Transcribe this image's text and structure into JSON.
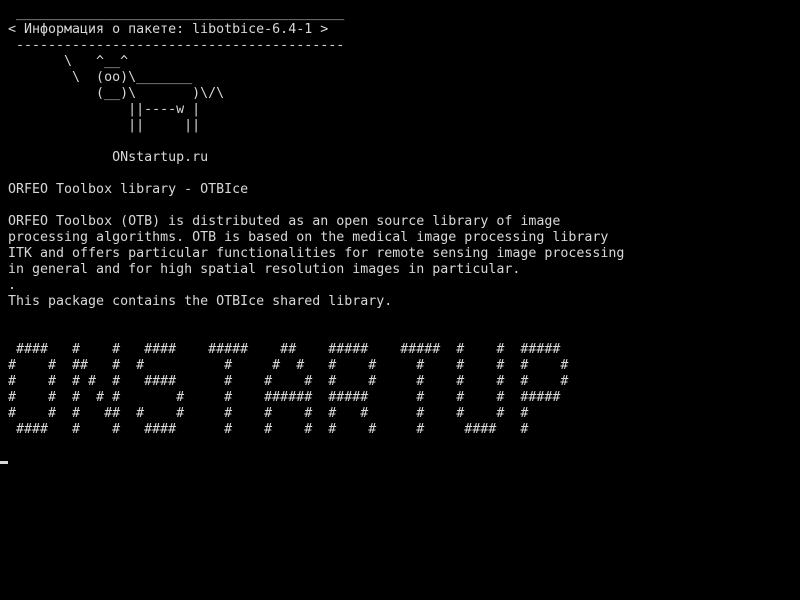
{
  "terminal": {
    "background": "#000000",
    "foreground": "#d8d8d8",
    "lines": [
      " _________________________________________",
      "< Информация о пакете: libotbice-6.4-1 >",
      " -----------------------------------------",
      "       \\   ^__^",
      "        \\  (oo)\\_______",
      "           (__)\\       )\\/\\",
      "               ||----w |",
      "               ||     ||",
      "",
      "             ONstartup.ru",
      "",
      "ORFEO Toolbox library - OTBIce",
      "",
      "ORFEO Toolbox (OTB) is distributed as an open source library of image",
      "processing algorithms. OTB is based on the medical image processing library",
      "ITK and offers particular functionalities for remote sensing image processing",
      "in general and for high spatial resolution images in particular.",
      ".",
      "This package contains the OTBIce shared library.",
      "",
      "",
      " ####   #    #   ####    #####    ##    #####    #####  #    #  #####",
      "#    #  ##   #  #          #     #  #   #    #     #    #    #  #    #",
      "#    #  # #  #   ####      #    #    #  #    #     #    #    #  #    #",
      "#    #  #  # #       #     #    ######  #####      #    #    #  #####",
      "#    #  #   ##  #    #     #    #    #  #   #      #    #    #  #",
      " ####   #    #   ####      #    #    #  #    #     #     ####   #"
    ]
  }
}
